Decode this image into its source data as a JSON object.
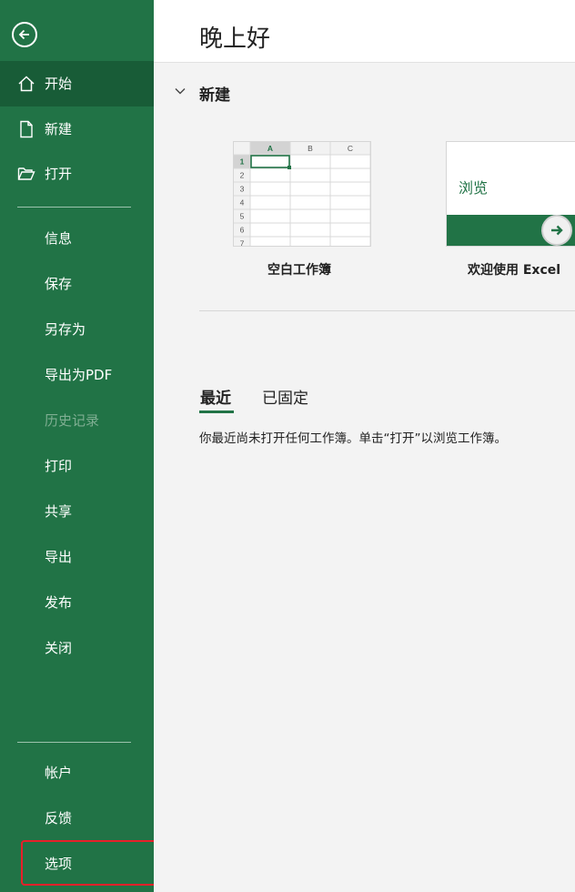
{
  "sidebar": {
    "top_items": [
      {
        "label": "开始",
        "icon": "home-icon"
      },
      {
        "label": "新建",
        "icon": "new-file-icon"
      },
      {
        "label": "打开",
        "icon": "folder-open-icon"
      }
    ],
    "mid_items": [
      {
        "label": "信息"
      },
      {
        "label": "保存"
      },
      {
        "label": "另存为"
      },
      {
        "label": "导出为PDF"
      },
      {
        "label": "历史记录"
      },
      {
        "label": "打印"
      },
      {
        "label": "共享"
      },
      {
        "label": "导出"
      },
      {
        "label": "发布"
      },
      {
        "label": "关闭"
      }
    ],
    "bottom_items": [
      {
        "label": "帐户"
      },
      {
        "label": "反馈"
      },
      {
        "label": "选项"
      }
    ]
  },
  "main": {
    "greeting": "晚上好",
    "new_section_title": "新建",
    "templates": [
      {
        "label": "空白工作簿"
      },
      {
        "label": "欢迎使用 Excel",
        "preview_text": "浏览"
      }
    ],
    "grid": {
      "columns": [
        "A",
        "B",
        "C"
      ],
      "rows": [
        "1",
        "2",
        "3",
        "4",
        "5",
        "6",
        "7"
      ]
    },
    "tabs": [
      {
        "label": "最近"
      },
      {
        "label": "已固定"
      }
    ],
    "empty_message": "你最近尚未打开任何工作簿。单击“打开”以浏览工作簿。"
  },
  "colors": {
    "brand": "#217346",
    "brand_dark": "#185c37",
    "highlight": "#e8202a"
  }
}
